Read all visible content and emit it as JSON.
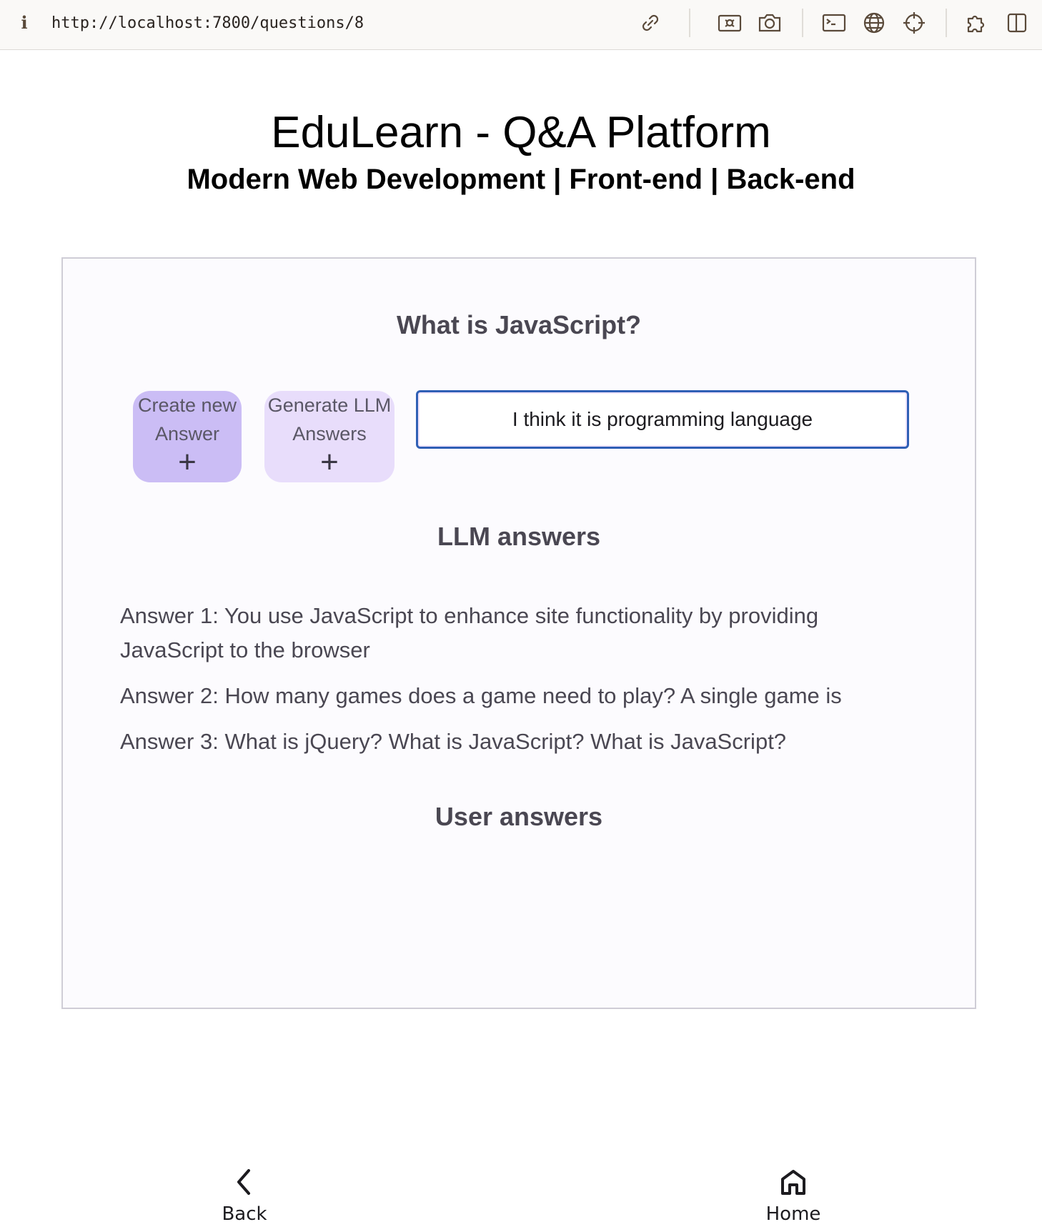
{
  "browser": {
    "info_glyph": "i",
    "url": "http://localhost:7800/questions/8",
    "icons": [
      "link-icon",
      "screenshot-icon",
      "camera-icon",
      "terminal-icon",
      "globe-icon",
      "crosshair-icon",
      "extensions-icon",
      "sidebar-icon"
    ]
  },
  "header": {
    "title": "EduLearn - Q&A Platform",
    "subtitle": "Modern Web Development | Front-end | Back-end"
  },
  "question": {
    "title": "What is JavaScript?",
    "create_button": {
      "line1": "Create new",
      "line2": "Answer",
      "plus": "+"
    },
    "generate_button": {
      "line1": "Generate LLM",
      "line2": "Answers",
      "plus": "+"
    },
    "answer_input_value": "I think it is programming language"
  },
  "llm_section": {
    "heading": "LLM answers",
    "answers": [
      "Answer 1: You use JavaScript to enhance site functionality by providing JavaScript to the browser",
      "Answer 2: How many games does a game need to play? A single game is",
      "Answer 3: What is jQuery? What is JavaScript? What is JavaScript?"
    ]
  },
  "user_section": {
    "heading": "User answers",
    "answers": []
  },
  "bottom_nav": {
    "back_label": "Back",
    "home_label": "Home"
  },
  "colors": {
    "create_button_bg": "#cbbdf5",
    "generate_button_bg": "#e8ddfb",
    "input_border": "#2f5fb5",
    "card_bg": "#fcfbfe",
    "text_muted": "#4a4752"
  }
}
